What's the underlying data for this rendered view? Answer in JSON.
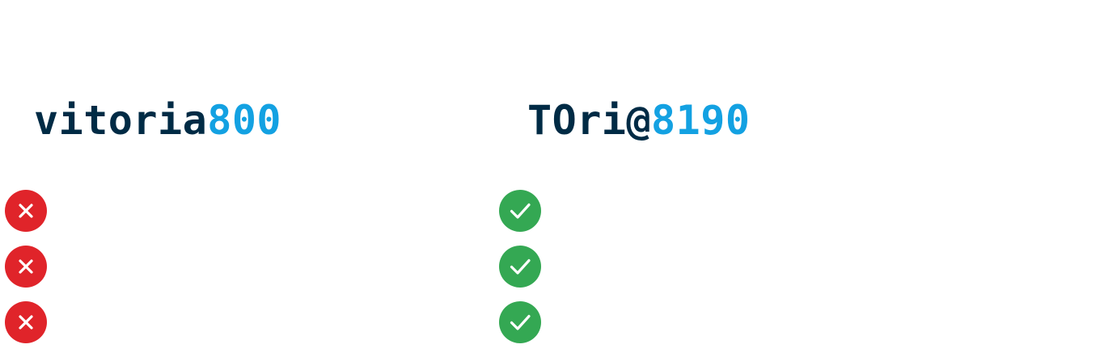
{
  "examples": [
    {
      "status": "invalid",
      "password": {
        "text_part": "vitoria",
        "number_part": "800"
      },
      "checks": [
        {
          "result": "fail",
          "icon": "cross-icon",
          "color": "#e0242a"
        },
        {
          "result": "fail",
          "icon": "cross-icon",
          "color": "#e0242a"
        },
        {
          "result": "fail",
          "icon": "cross-icon",
          "color": "#e0242a"
        }
      ]
    },
    {
      "status": "valid",
      "password": {
        "text_part": "TOri@",
        "number_part": "8190"
      },
      "checks": [
        {
          "result": "pass",
          "icon": "check-icon",
          "color": "#34a853"
        },
        {
          "result": "pass",
          "icon": "check-icon",
          "color": "#34a853"
        },
        {
          "result": "pass",
          "icon": "check-icon",
          "color": "#34a853"
        }
      ]
    }
  ],
  "colors": {
    "text_dark": "#002b45",
    "number_blue": "#13a1e2",
    "fail_red": "#e0242a",
    "pass_green": "#34a853"
  }
}
